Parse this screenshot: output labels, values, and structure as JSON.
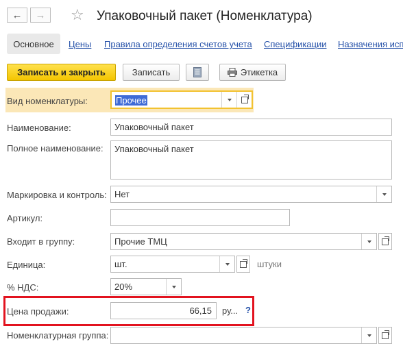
{
  "header": {
    "back_icon": "←",
    "forward_icon": "→",
    "star_icon": "☆",
    "title": "Упаковочный пакет (Номенклатура)"
  },
  "tabs": {
    "active": "Основное",
    "links": [
      "Цены",
      "Правила определения счетов учета",
      "Спецификации",
      "Назначения исп"
    ]
  },
  "toolbar": {
    "save_close": "Записать и закрыть",
    "save": "Записать",
    "label_btn": "Этикетка"
  },
  "form": {
    "kind_label": "Вид номенклатуры:",
    "kind_value": "Прочее",
    "name_label": "Наименование:",
    "name_value": "Упаковочный пакет",
    "fullname_label": "Полное наименование:",
    "fullname_value": "Упаковочный пакет",
    "marking_label": "Маркировка и контроль:",
    "marking_value": "Нет",
    "article_label": "Артикул:",
    "article_value": "",
    "group_label": "Входит в группу:",
    "group_value": "Прочие ТМЦ",
    "unit_label": "Единица:",
    "unit_value": "шт.",
    "unit_full": "штуки",
    "vat_label": "% НДС:",
    "vat_value": "20%",
    "price_label": "Цена продажи:",
    "price_value": "66,15",
    "currency": "ру...",
    "help": "?",
    "nomgroup_label": "Номенклатурная группа:",
    "nomgroup_value": ""
  },
  "colors": {
    "accent_yellow": "#f4c500",
    "highlight": "#fbe7b7",
    "link": "#2450a8",
    "red_frame": "#e2131f"
  }
}
